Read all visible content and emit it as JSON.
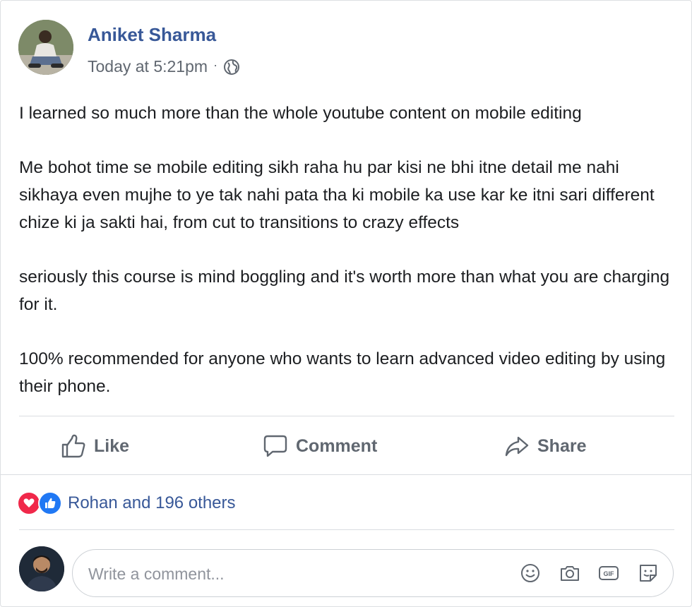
{
  "post": {
    "author": "Aniket Sharma",
    "timestamp": "Today at 5:21pm",
    "separator": "·",
    "privacy_icon": "globe-icon",
    "paragraphs": [
      "I learned so much more than the whole youtube content on mobile editing",
      "Me bohot time se mobile editing sikh raha hu par kisi ne bhi itne detail me nahi sikhaya even mujhe to ye tak nahi pata tha ki mobile ka use kar ke itni sari different chize ki ja sakti hai, from cut to transitions to crazy effects",
      "seriously this course is mind boggling and it's worth more than what you are charging for it.",
      "100% recommended for anyone who wants to learn advanced video editing by using their phone."
    ]
  },
  "actions": {
    "like": {
      "label": "Like",
      "icon": "thumbs-up-icon"
    },
    "comment": {
      "label": "Comment",
      "icon": "speech-bubble-icon"
    },
    "share": {
      "label": "Share",
      "icon": "share-arrow-icon"
    }
  },
  "reactions": {
    "icons": [
      "love-reaction-icon",
      "like-reaction-icon"
    ],
    "summary": "Rohan and 196 others"
  },
  "comment": {
    "placeholder": "Write a comment...",
    "icons": [
      "emoji-icon",
      "camera-icon",
      "gif-icon",
      "sticker-icon"
    ]
  },
  "colors": {
    "author_link": "#385898",
    "love": "#f0284a",
    "like": "#2078f4",
    "muted_text": "#606770"
  }
}
